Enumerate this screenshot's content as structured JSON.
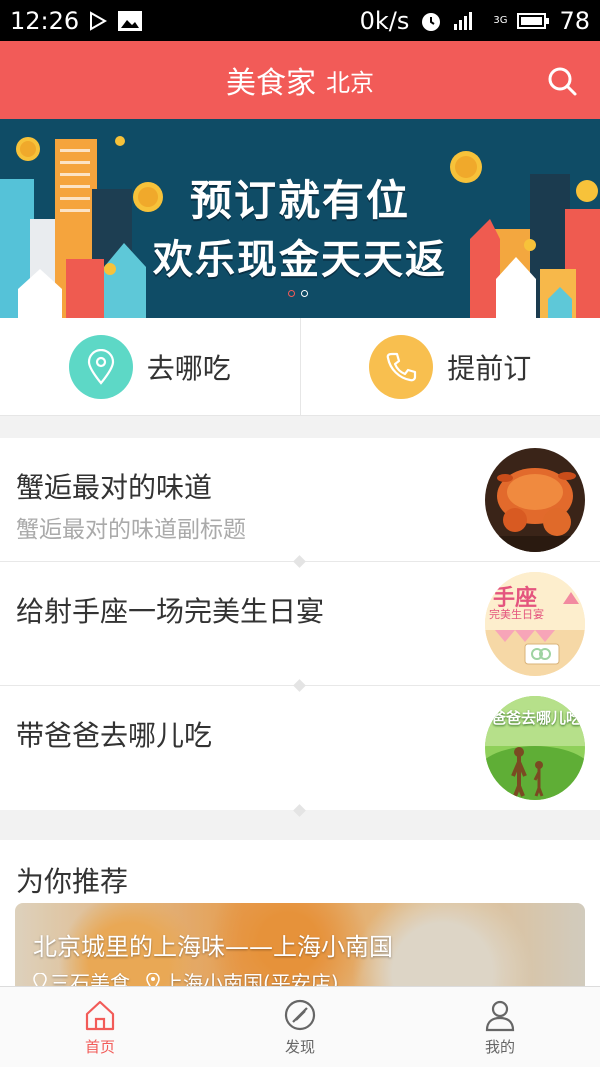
{
  "status_bar": {
    "time": "12:26",
    "net_speed": "0k/s",
    "network": "3G",
    "battery": "78"
  },
  "header": {
    "title": "美食家",
    "city": "北京"
  },
  "banner": {
    "line1": "预订就有位",
    "line2": "欢乐现金天天返",
    "slide_count": 2,
    "active_slide": 1
  },
  "quick_actions": [
    {
      "label": "去哪吃",
      "color": "#5dd8c6",
      "icon": "location-pin-icon"
    },
    {
      "label": "提前订",
      "color": "#f8bf4f",
      "icon": "phone-icon"
    }
  ],
  "topics": [
    {
      "title": "蟹逅最对的味道",
      "subtitle": "蟹逅最对的味道副标题",
      "thumb": "crab-photo"
    },
    {
      "title": "给射手座一场完美生日宴",
      "subtitle": "",
      "thumb": "birthday-party-photo",
      "thumb_text": "手座",
      "thumb_text2": "完美生日宴"
    },
    {
      "title": "带爸爸去哪儿吃",
      "subtitle": "",
      "thumb": "dad-where-photo",
      "thumb_text": "爸爸去哪儿吃"
    }
  ],
  "recommend": {
    "title": "为你推荐",
    "card": {
      "name": "北京城里的上海味——上海小南国",
      "area": "三石美食",
      "shop": "上海小南国(平安店)"
    }
  },
  "tabbar": [
    {
      "label": "首页",
      "icon": "home-icon",
      "active": true
    },
    {
      "label": "发现",
      "icon": "compass-icon",
      "active": false
    },
    {
      "label": "我的",
      "icon": "user-icon",
      "active": false
    }
  ],
  "colors": {
    "brand": "#f25b58",
    "banner_bg": "#0f4c66"
  }
}
